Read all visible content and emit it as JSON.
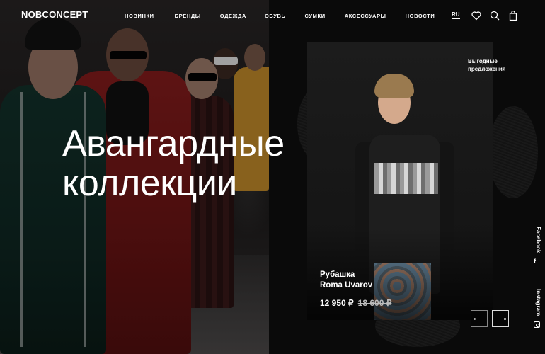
{
  "header": {
    "logo": "NOBCONCEPT",
    "nav": [
      "НОВИНКИ",
      "БРЕНДЫ",
      "ОДЕЖДА",
      "ОБУВЬ",
      "СУМКИ",
      "АКСЕССУАРЫ",
      "НОВОСТИ"
    ],
    "lang": "RU",
    "icons": [
      "heart-icon",
      "search-icon",
      "bag-icon"
    ]
  },
  "hero": {
    "title_line1": "Авангардные",
    "title_line2": "коллекции"
  },
  "offers": {
    "line1": "Выгодные",
    "line2": "предложения"
  },
  "product": {
    "name_line1": "Рубашка",
    "name_line2": "Roma Uvarov",
    "price": "12 950 ₽",
    "old_price": "18 600 ₽"
  },
  "social": {
    "facebook": "Facebook",
    "facebook_icon": "f",
    "instagram": "Instagram"
  },
  "slider": {
    "prev_icon": "arrow-left-icon",
    "next_icon": "arrow-right-icon"
  }
}
